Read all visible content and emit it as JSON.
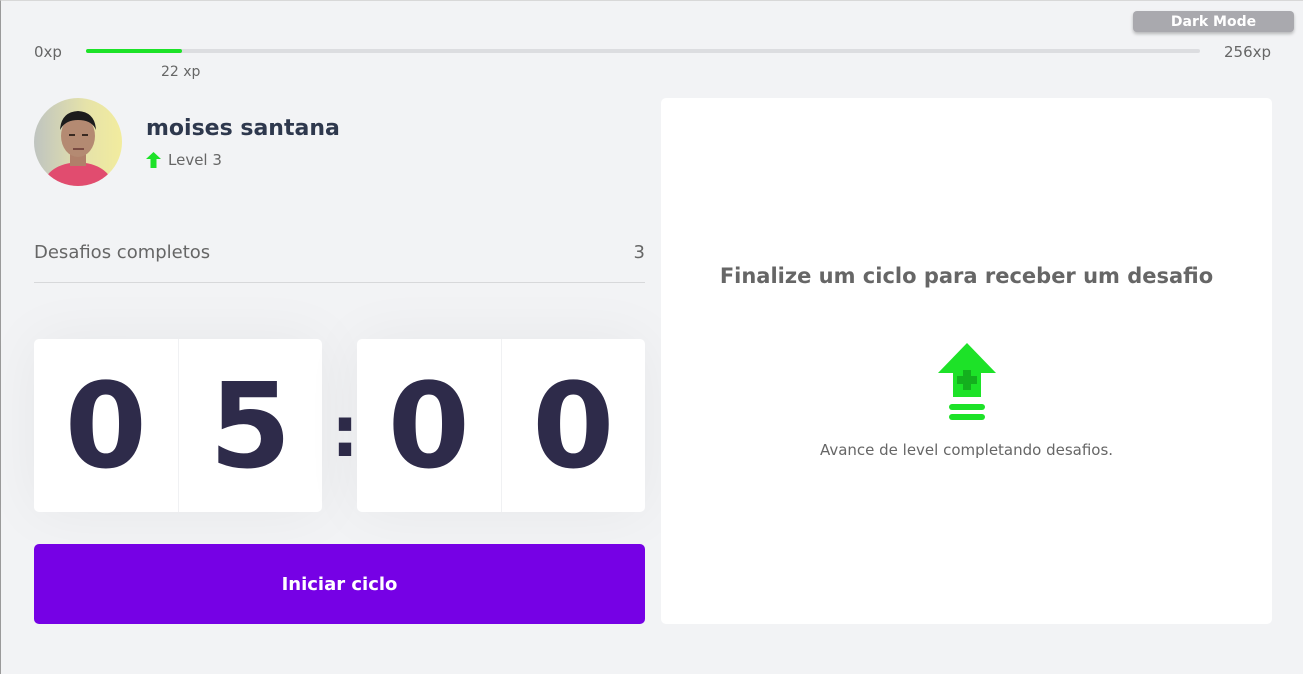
{
  "header": {
    "dark_mode_label": "Dark Mode"
  },
  "experience": {
    "min_label": "0xp",
    "max_label": "256xp",
    "current_label": "22 xp",
    "progress_fraction": 0.086,
    "accent_color": "#1de228"
  },
  "profile": {
    "name": "moises santana",
    "level_label": "Level 3",
    "level_icon": "arrow-up-icon"
  },
  "challenges": {
    "completed_label": "Desafios completos",
    "completed_count": "3"
  },
  "countdown": {
    "minute_left": "0",
    "minute_right": "5",
    "separator": ":",
    "second_left": "0",
    "second_right": "0"
  },
  "actions": {
    "start_label": "Iniciar ciclo",
    "button_color": "#7601e5"
  },
  "challenge_box": {
    "title": "Finalize um ciclo para receber um desafio",
    "hint": "Avance de level completando desafios.",
    "icon": "level-up-icon"
  }
}
